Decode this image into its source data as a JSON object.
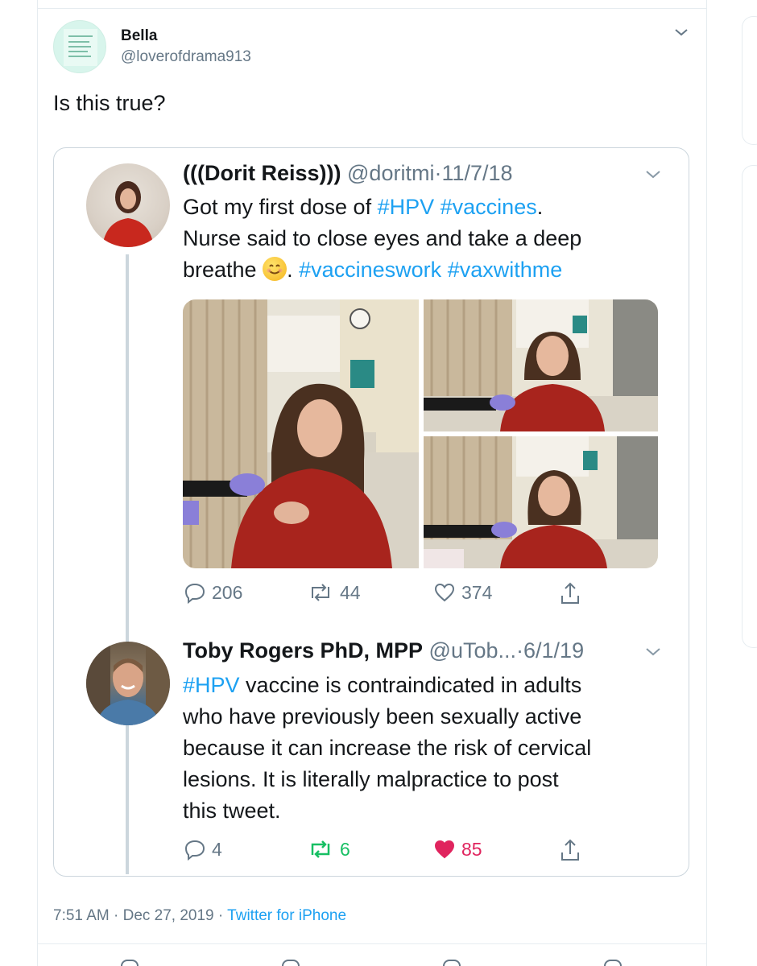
{
  "tweet": {
    "author_name": "Bella",
    "author_handle": "@loverofdrama913",
    "text": "Is this true?",
    "timestamp": "7:51 AM · Dec 27, 2019",
    "separator": "·",
    "source": "Twitter for iPhone"
  },
  "quoted": [
    {
      "name": "(((Dorit Reiss)))",
      "handle": "@doritmi",
      "date": "11/7/18",
      "body": [
        {
          "t": "Got my first dose of ",
          "tag": false
        },
        {
          "t": "#HPV",
          "tag": true
        },
        {
          "t": " ",
          "tag": false
        },
        {
          "t": "#vaccines",
          "tag": true
        },
        {
          "t": ".",
          "tag": false
        }
      ],
      "line2": "Nurse said to close eyes and take a deep",
      "line3_pre": "breathe",
      "line3_mid": ". ",
      "line3_tag1": "#vaccineswork",
      "line3_tag2": "#vaxwithme",
      "replies": "206",
      "retweets": "44",
      "likes": "374"
    },
    {
      "name": "Toby Rogers PhD, MPP",
      "handle": "@uTob...",
      "date": "6/1/19",
      "tag": "#HPV",
      "line1_rest": " vaccine is contraindicated in adults",
      "line2": "who have previously been sexually active",
      "line3": "because it can increase the risk of cervical",
      "line4": "lesions. It is literally malpractice to post",
      "line5": "this tweet.",
      "replies": "4",
      "retweets": "6",
      "likes": "85"
    }
  ],
  "colors": {
    "link": "#1da1f2",
    "muted": "#657786",
    "retweet_active": "#17bf63",
    "like_active": "#e0245e"
  },
  "icons": [
    "chevron-down-icon",
    "reply-icon",
    "retweet-icon",
    "like-icon",
    "share-icon"
  ]
}
